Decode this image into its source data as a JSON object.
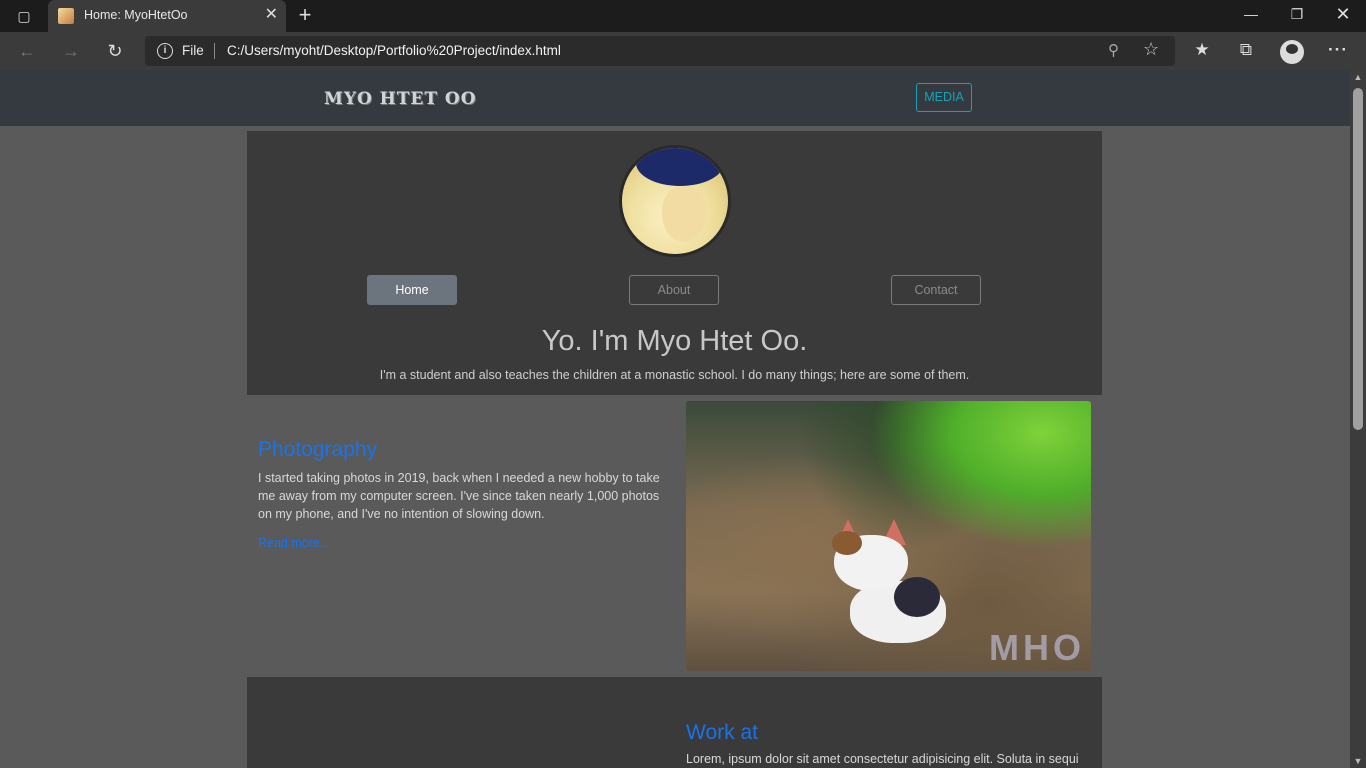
{
  "browser": {
    "tab_title": "Home: MyoHtetOo",
    "scheme_label": "File",
    "url": "C:/Users/myoht/Desktop/Portfolio%20Project/index.html"
  },
  "site": {
    "brand": "MYO HTET OO",
    "media_button": "MEDIA",
    "nav": {
      "home": "Home",
      "about": "About",
      "contact": "Contact"
    },
    "hero_title": "Yo. I'm Myo Htet Oo.",
    "hero_subtitle": "I'm a student and also teaches the children at a monastic school. I do many things; here are some of them.",
    "photography": {
      "title": "Photography",
      "body": "I started taking photos in 2019, back when I needed a new hobby to take me away from my computer screen. I've since taken nearly 1,000 photos on my phone, and I've no intention of slowing down.",
      "read_more": "Read more..",
      "watermark": "MHO"
    },
    "work": {
      "title": "Work at",
      "body": "Lorem, ipsum dolor sit amet consectetur adipisicing elit. Soluta in sequi"
    }
  },
  "icons": {
    "tab_actions": "tab-actions-icon",
    "back": "back-arrow-icon",
    "forward": "forward-arrow-icon",
    "reload": "reload-icon",
    "info": "info-icon",
    "zoom": "zoom-out-icon",
    "add_favorite": "add-favorite-icon",
    "favorites": "favorites-icon",
    "collections": "collections-icon",
    "profile": "profile-icon",
    "more": "more-icon"
  },
  "colors": {
    "accent_link": "#1a73e8",
    "media_button": "#17a2b8",
    "navbar_bg": "#343a40",
    "page_bg": "#5a5a5a",
    "section_bg": "#3a3a3a",
    "home_pill_bg": "#6c757d"
  }
}
